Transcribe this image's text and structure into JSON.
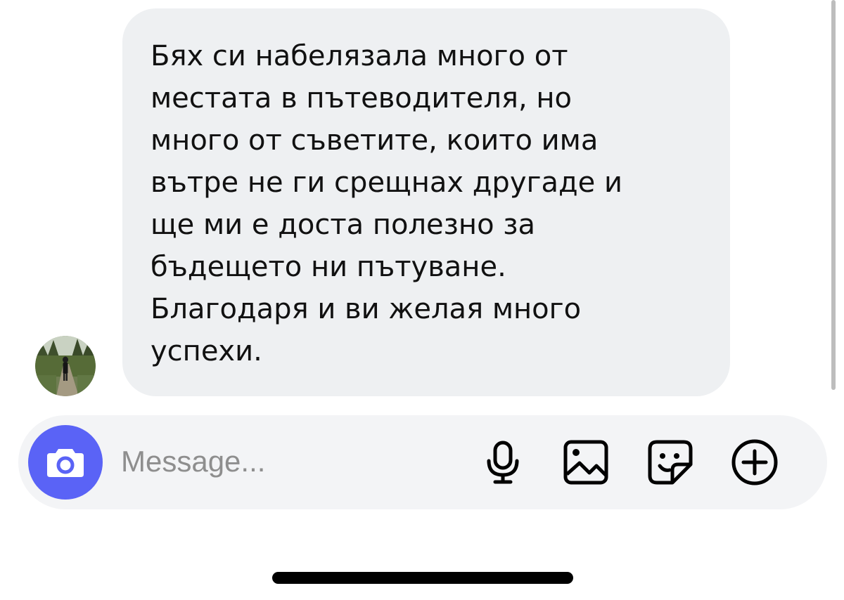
{
  "conversation": {
    "message": {
      "text": "Бях си набелязала много от\nместата в пътеводителя, но\nмного от съветите, които има\nвътре не ги срещнах другаде и\nще ми е доста полезно за\nбъдещето ни пътуване.\nБлагодаря и ви желая много\nуспехи."
    },
    "avatar": {
      "icon": "profile-photo"
    }
  },
  "composer": {
    "placeholder": "Message...",
    "value": "",
    "accent_color": "#5a63f6",
    "icons": [
      "camera-icon",
      "microphone-icon",
      "gallery-icon",
      "sticker-icon",
      "plus-icon"
    ]
  }
}
